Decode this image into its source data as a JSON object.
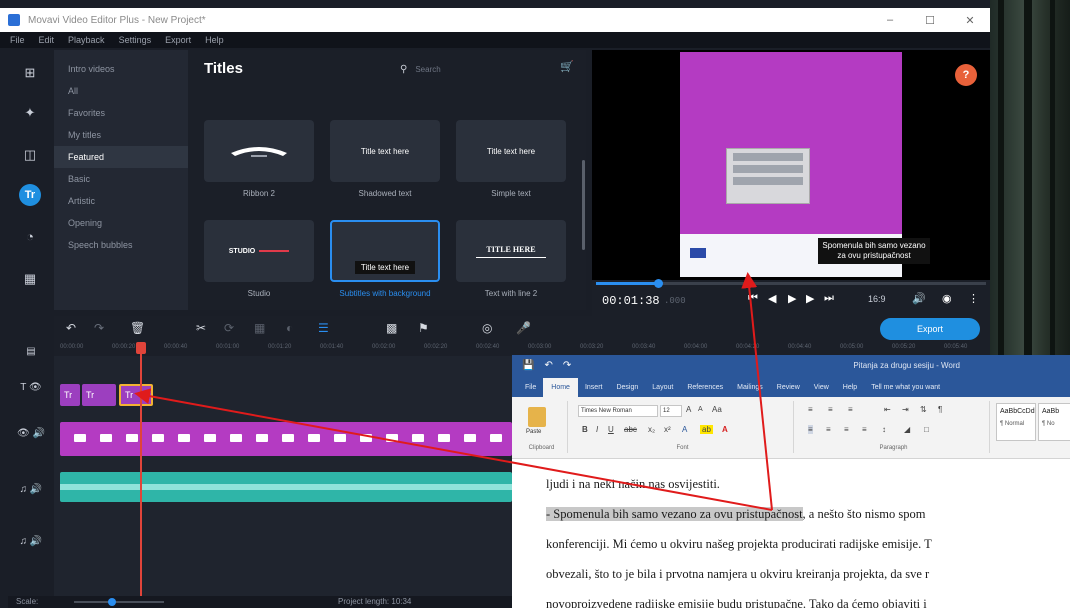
{
  "window": {
    "title": "Movavi Video Editor Plus - New Project*",
    "controls": [
      "–",
      "☐",
      "✕"
    ]
  },
  "menu": [
    "File",
    "Edit",
    "Playback",
    "Settings",
    "Export",
    "Help"
  ],
  "left_tools": [
    "import-icon",
    "magic-icon",
    "filters-icon",
    "titles-icon",
    "transitions-icon",
    "more-tools-icon"
  ],
  "titles_panel": {
    "heading": "Titles",
    "search_placeholder": "Search",
    "categories": [
      "Intro videos",
      "All",
      "Favorites",
      "My titles",
      "Featured",
      "Basic",
      "Artistic",
      "Opening",
      "Speech bubbles"
    ],
    "selected_category": "Featured",
    "tiles": [
      {
        "label": "Ribbon 2",
        "preview": ""
      },
      {
        "label": "Shadowed text",
        "preview": "Title text here"
      },
      {
        "label": "Simple text",
        "preview": "Title text here"
      },
      {
        "label": "Studio",
        "preview": "STUDIO"
      },
      {
        "label": "Subtitles with background",
        "preview": "Title text here"
      },
      {
        "label": "Text with line 2",
        "preview": "TITLE HERE"
      }
    ]
  },
  "preview": {
    "caption": "Spomenula bih samo vezano za ovu pristupačnost",
    "help": "?"
  },
  "playback": {
    "timecode": "00:01:38",
    "timecode_extra": ".000",
    "aspect": "16:9",
    "progress": 0.16
  },
  "timeline": {
    "export_label": "Export",
    "ruler": [
      "00:00:00",
      "00:00:20",
      "00:00:40",
      "00:01:00",
      "00:01:20",
      "00:01:40",
      "00:02:00",
      "00:02:20",
      "00:02:40",
      "00:03:00",
      "00:03:20",
      "00:03:40",
      "00:04:00",
      "00:04:20",
      "00:04:40",
      "00:05:00",
      "00:05:20",
      "00:05:40"
    ],
    "title_clips": [
      "Tr",
      "Tr",
      "Tr"
    ],
    "scale_label": "Scale:",
    "project_length": "Project length: 10:34"
  },
  "word": {
    "title": "Pitanja za drugu sesiju - Word",
    "tabs": [
      "File",
      "Home",
      "Insert",
      "Design",
      "Layout",
      "References",
      "Mailings",
      "Review",
      "View",
      "Help",
      "Tell me what you want"
    ],
    "selected_tab": "Home",
    "font": "Times New Roman",
    "size": "12",
    "groups": [
      "Clipboard",
      "Font",
      "Paragraph"
    ],
    "paste_label": "Paste",
    "styles": [
      {
        "sample": "AaBbCcDd",
        "name": "¶ Normal"
      },
      {
        "sample": "AaBb",
        "name": "¶ No"
      }
    ],
    "doc_lines": [
      "ljudi i na neki način nas osvijestiti.",
      "konferenciji. Mi ćemo u okviru našeg projekta producirati radijske emisije. T",
      "obvezali, što to je bila i prvotna namjera u okviru kreiranja projekta, da sve r",
      "novoproizvedene radijske emisije budu pristupačne. Tako da ćemo objaviti i"
    ],
    "highlight_text": "- Spomenula bih samo vezano za ovu pristupačnost",
    "line2_rest": ", a nešto što nismo spom"
  },
  "colors": {
    "accent": "#1f8fe0",
    "title_clip": "#9c3fbf",
    "video_track": "#b43bc2",
    "audio_track": "#2fb5a8",
    "word_blue": "#2b579a",
    "annotation_red": "#e01b1b"
  }
}
